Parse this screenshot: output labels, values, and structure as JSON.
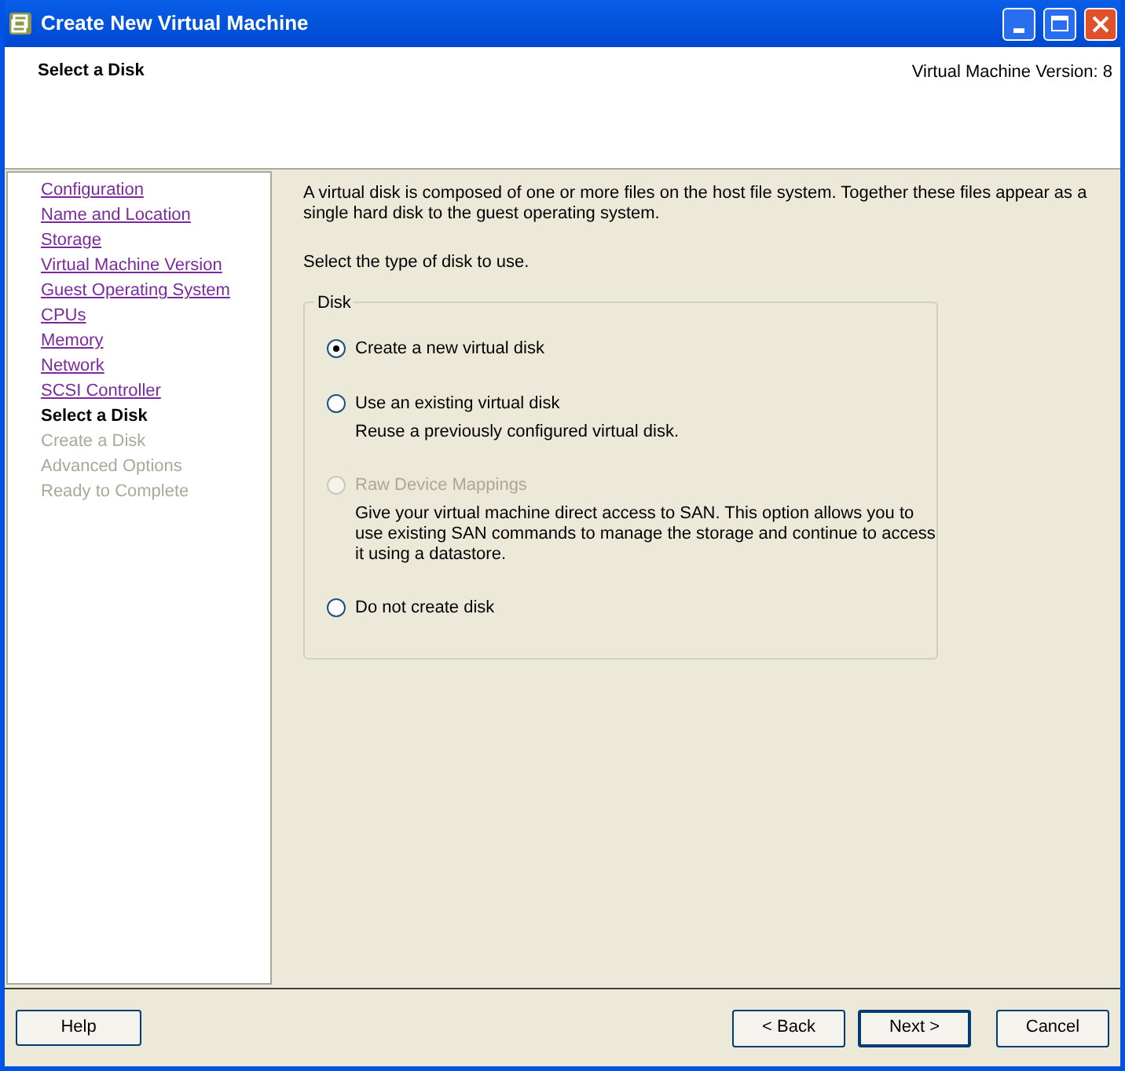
{
  "window": {
    "title": "Create New Virtual Machine"
  },
  "header": {
    "title": "Select a Disk",
    "version": "Virtual Machine Version: 8"
  },
  "steps": [
    {
      "label": "Configuration",
      "kind": "done"
    },
    {
      "label": "Name and Location",
      "kind": "done"
    },
    {
      "label": "Storage",
      "kind": "done"
    },
    {
      "label": "Virtual Machine Version",
      "kind": "done"
    },
    {
      "label": "Guest Operating System",
      "kind": "done"
    },
    {
      "label": "CPUs",
      "kind": "done"
    },
    {
      "label": "Memory",
      "kind": "done"
    },
    {
      "label": "Network",
      "kind": "done"
    },
    {
      "label": "SCSI Controller",
      "kind": "done"
    },
    {
      "label": "Select a Disk",
      "kind": "current"
    },
    {
      "label": "Create a Disk",
      "kind": "pending"
    },
    {
      "label": "Advanced Options",
      "kind": "pending"
    },
    {
      "label": "Ready to Complete",
      "kind": "pending"
    }
  ],
  "intro": "A virtual disk is composed of one or more files on the host file system. Together these files appear as a single hard disk to the guest operating system.",
  "prompt": "Select the type of disk to use.",
  "disk_group": {
    "legend": "Disk",
    "options": [
      {
        "label": "Create a new virtual disk",
        "selected": true,
        "disabled": false
      },
      {
        "label": "Use an existing virtual disk",
        "selected": false,
        "disabled": false,
        "description": "Reuse a previously configured virtual disk."
      },
      {
        "label": "Raw Device Mappings",
        "selected": false,
        "disabled": true,
        "description": "Give your virtual machine direct access to SAN. This option allows you to use existing SAN commands to manage the storage and continue to access it using a datastore."
      },
      {
        "label": "Do not create disk",
        "selected": false,
        "disabled": false
      }
    ]
  },
  "buttons": {
    "help": "Help",
    "back": "< Back",
    "next": "Next >",
    "cancel": "Cancel"
  }
}
